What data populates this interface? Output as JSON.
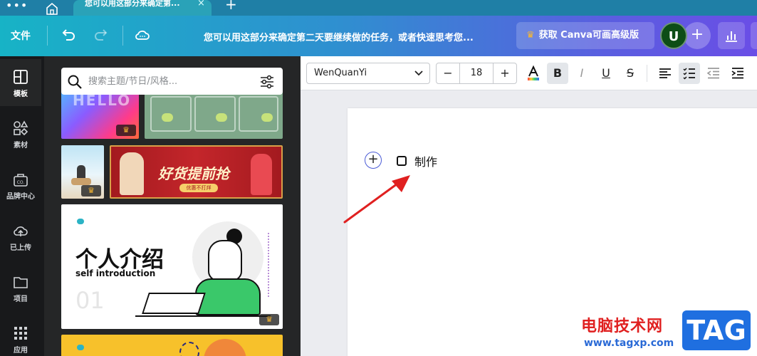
{
  "browser": {
    "tab_title": "您可以用这部分来确定第...",
    "tab_close": "×",
    "new_tab": "+"
  },
  "header": {
    "file_label": "文件",
    "doc_title": "您可以用这部分来确定第二天要继续做的任务，或者快速思考您...",
    "premium_label": "获取 Canva可画高级版",
    "premium_crown": "♛",
    "avatar_initial": "U",
    "add_label": "+"
  },
  "rail": {
    "items": [
      {
        "label": "模板",
        "icon": "template-icon"
      },
      {
        "label": "素材",
        "icon": "elements-icon"
      },
      {
        "label": "品牌中心",
        "icon": "brand-icon"
      },
      {
        "label": "已上传",
        "icon": "upload-icon"
      },
      {
        "label": "项目",
        "icon": "folder-icon"
      },
      {
        "label": "应用",
        "icon": "apps-icon"
      }
    ]
  },
  "panel": {
    "search_placeholder": "搜索主题/节日/风格...",
    "cards": {
      "hello_text": "HELLO",
      "banner_text": "好货提前抢",
      "banner_sub": "优惠不打烊",
      "intro_title": "个人介绍",
      "intro_sub": "self introduction",
      "intro_num": "01"
    },
    "crown": "♛"
  },
  "toolbar": {
    "font_name": "WenQuanYi",
    "font_size": "18",
    "minus": "−",
    "plus": "+",
    "bold": "B",
    "italic": "I",
    "underline": "U",
    "strike": "S"
  },
  "canvas": {
    "add_symbol": "+",
    "task_text": "制作"
  },
  "watermark": {
    "site_name": "电脑技术网",
    "url": "www.tagxp.com",
    "tag": "TAG"
  },
  "colors": {
    "header_start": "#17b3c6",
    "header_end": "#6a4ee6",
    "rail_bg": "#18191b",
    "panel_bg": "#252627",
    "arrow": "#e02020"
  }
}
